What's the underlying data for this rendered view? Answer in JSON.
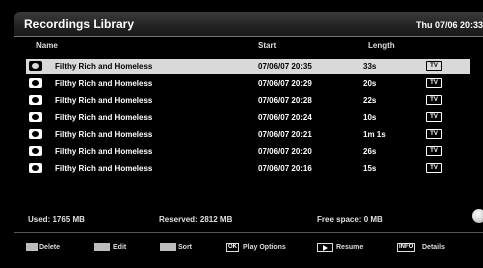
{
  "header": {
    "title": "Recordings Library",
    "datetime": "Thu 07/06 20:33"
  },
  "columns": {
    "name": "Name",
    "start": "Start",
    "length": "Length"
  },
  "recordings": [
    {
      "name": "Filthy Rich and Homeless",
      "start": "07/06/07 20:35",
      "length": "33s",
      "badge": "TV",
      "selected": true
    },
    {
      "name": "Filthy Rich and Homeless",
      "start": "07/06/07 20:29",
      "length": "20s",
      "badge": "TV"
    },
    {
      "name": "Filthy Rich and Homeless",
      "start": "07/06/07 20:28",
      "length": "22s",
      "badge": "TV"
    },
    {
      "name": "Filthy Rich and Homeless",
      "start": "07/06/07 20:24",
      "length": "10s",
      "badge": "TV"
    },
    {
      "name": "Filthy Rich and Homeless",
      "start": "07/06/07 20:21",
      "length": "1m 1s",
      "badge": "TV"
    },
    {
      "name": "Filthy Rich and Homeless",
      "start": "07/06/07 20:20",
      "length": "26s",
      "badge": "TV"
    },
    {
      "name": "Filthy Rich and Homeless",
      "start": "07/06/07 20:16",
      "length": "15s",
      "badge": "TV"
    }
  ],
  "status": {
    "used": "Used: 1765 MB",
    "reserved": "Reserved: 2812 MB",
    "free": "Free space: 0 MB"
  },
  "footer": {
    "delete": "Delete",
    "edit": "Edit",
    "sort": "Sort",
    "ok_key": "OK",
    "play_options": "Play Options",
    "resume": "Resume",
    "info_key": "INFO",
    "details": "Details"
  }
}
